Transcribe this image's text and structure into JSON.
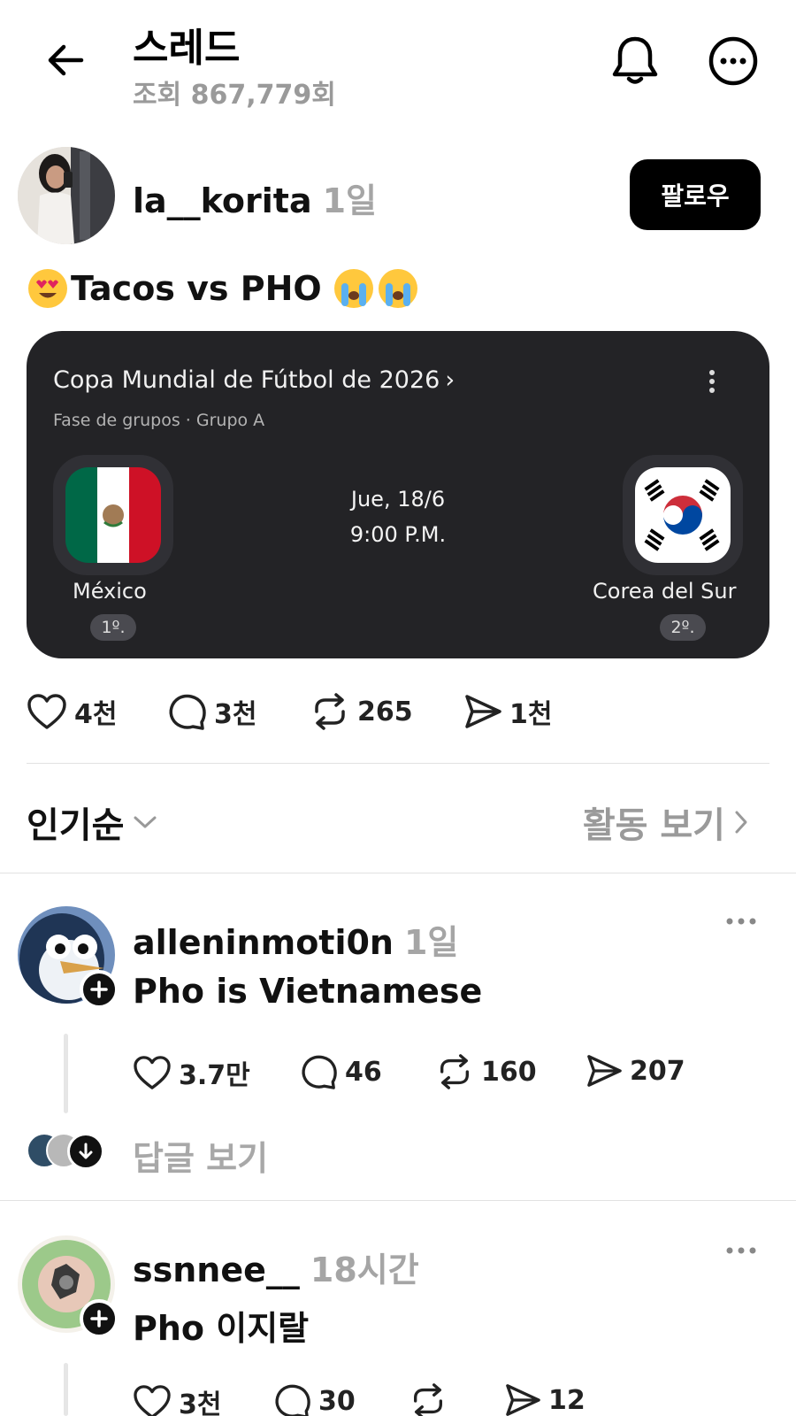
{
  "header": {
    "title": "스레드",
    "views": "조회 867,779회"
  },
  "post": {
    "username": "la__korita",
    "time": "1일",
    "follow_label": "팔로우",
    "text": "Tacos vs PHO",
    "stats": {
      "likes": "4천",
      "comments": "3천",
      "reposts": "265",
      "shares": "1천"
    }
  },
  "match_card": {
    "competition": "Copa Mundial de Fútbol de 2026",
    "stage": "Fase de grupos · Grupo A",
    "date": "Jue, 18/6",
    "time": "9:00 P.M.",
    "home": {
      "name": "México",
      "rank": "1º."
    },
    "away": {
      "name": "Corea del Sur",
      "rank": "2º."
    }
  },
  "sort": {
    "label": "인기순",
    "activity_label": "활동 보기"
  },
  "replies": [
    {
      "username": "alleninmoti0n",
      "time": "1일",
      "text": "Pho is Vietnamese",
      "stats": {
        "likes": "3.7만",
        "comments": "46",
        "reposts": "160",
        "shares": "207"
      },
      "view_replies": "답글 보기"
    },
    {
      "username": "ssnnee__",
      "time": "18시간",
      "text": "Pho 이지랄",
      "stats": {
        "likes": "3천",
        "comments": "30",
        "shares": "12"
      }
    }
  ]
}
